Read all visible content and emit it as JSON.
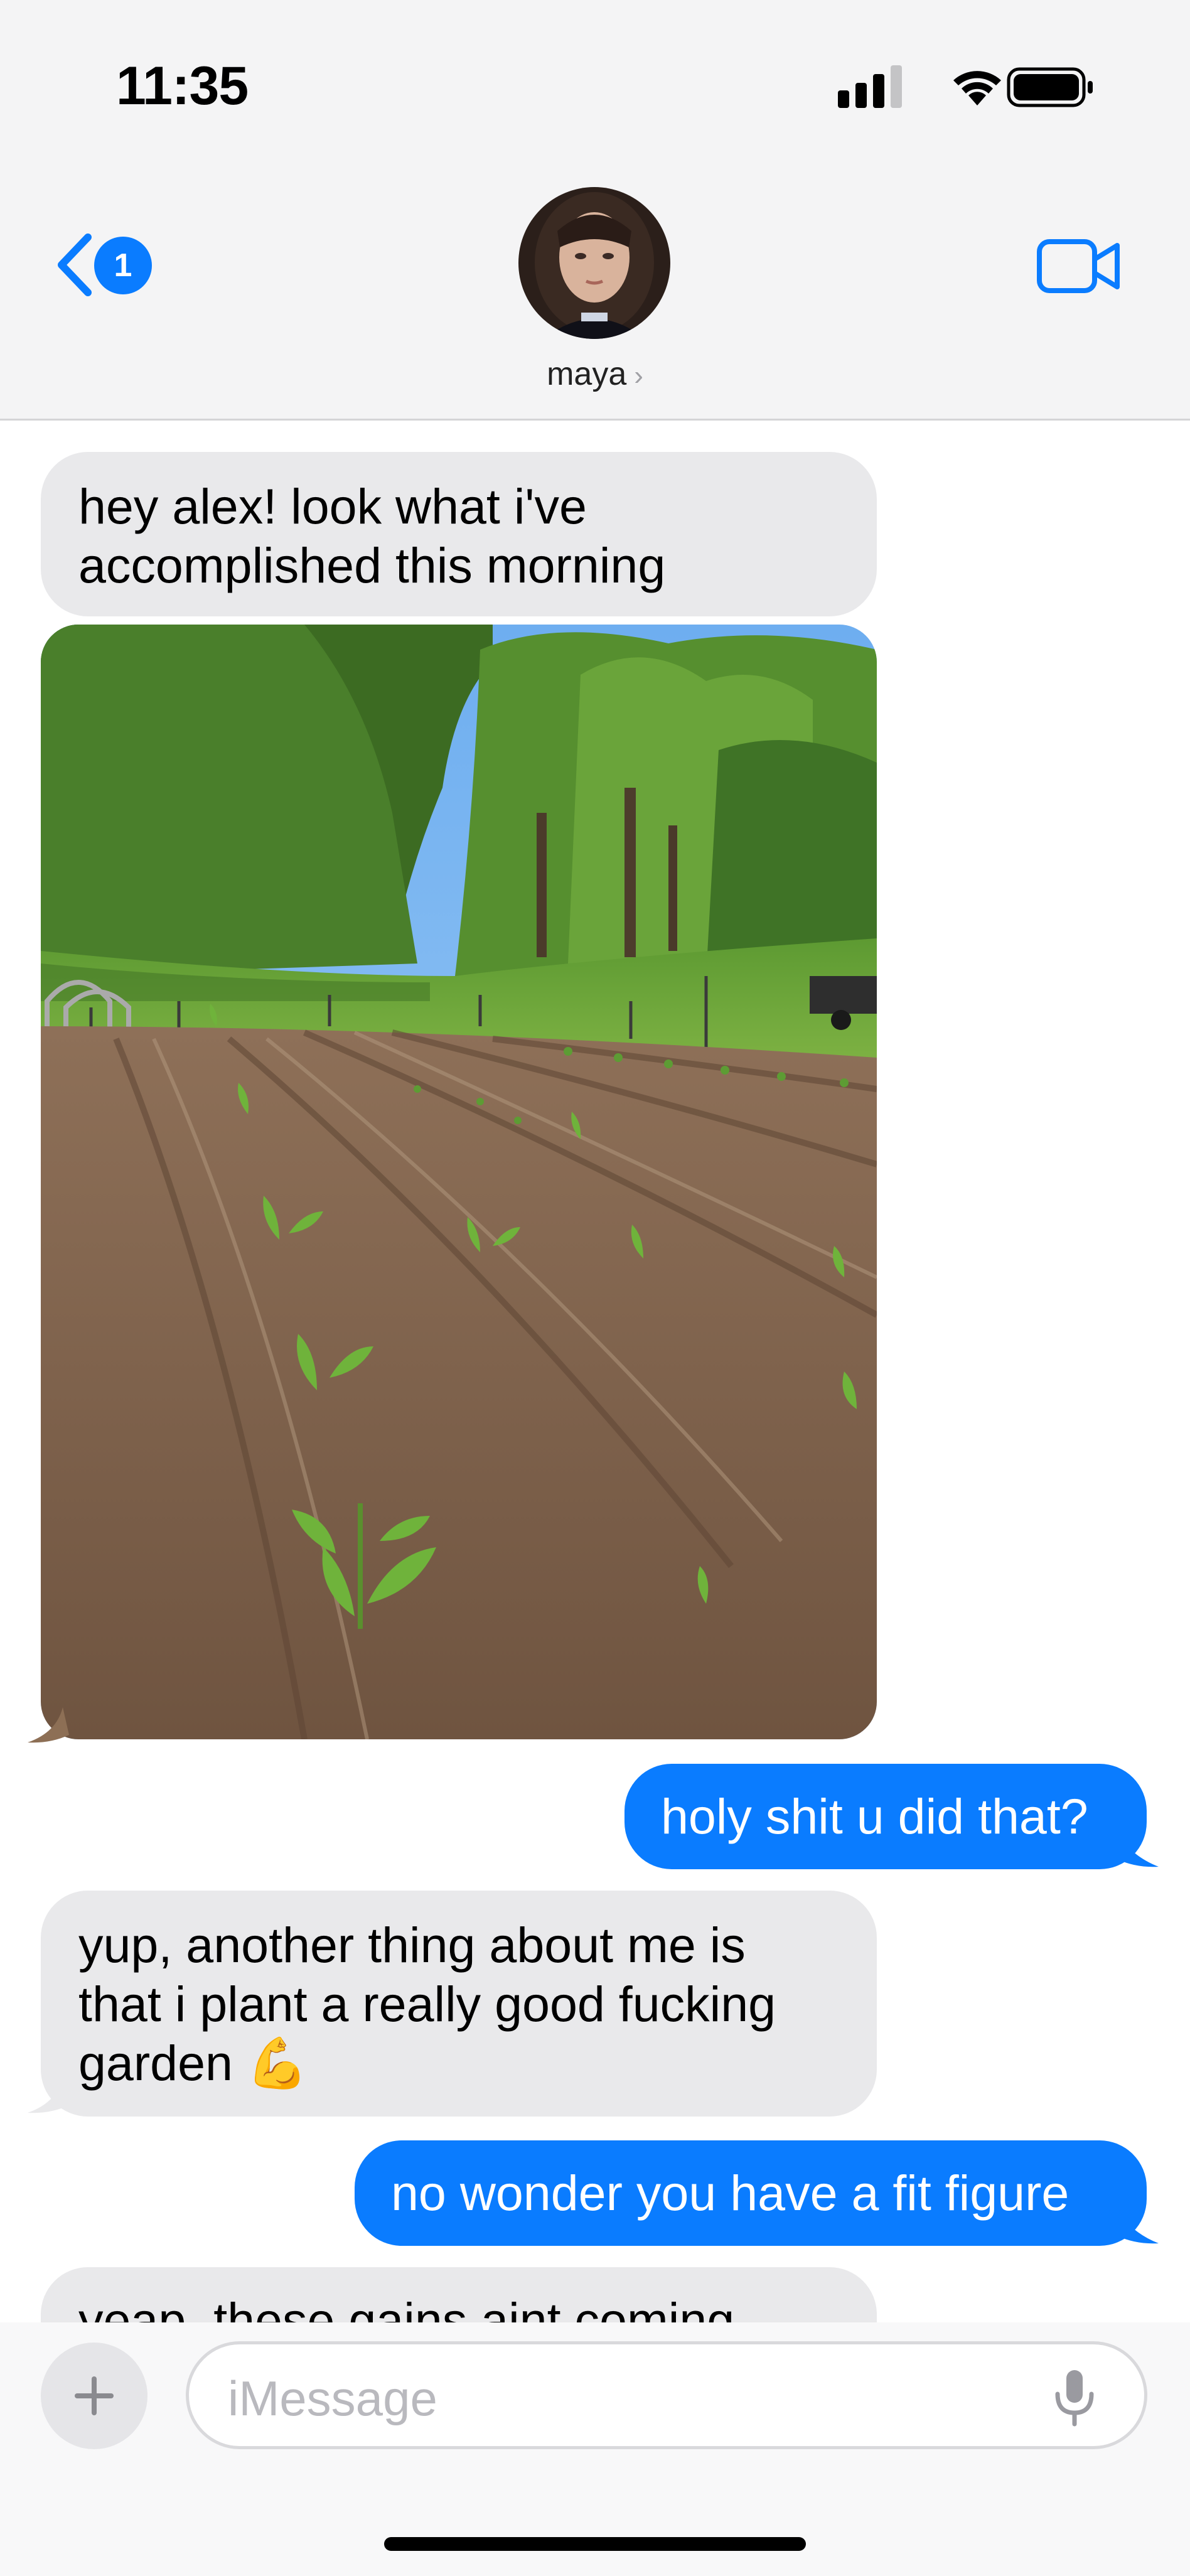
{
  "status_bar": {
    "time": "11:35",
    "icons": [
      "signal-icon",
      "wifi-icon",
      "battery-icon"
    ]
  },
  "header": {
    "back_badge": "1",
    "contact_name": "maya",
    "contact_chevron": "›",
    "icons": {
      "back": "chevron-left-icon",
      "video": "video-camera-icon"
    }
  },
  "messages": [
    {
      "direction": "incoming",
      "text_lines": [
        "hey alex! look what i've",
        "accomplished this morning"
      ]
    },
    {
      "direction": "incoming",
      "type": "photo",
      "subject": "garden-photo"
    },
    {
      "direction": "outgoing",
      "text": "holy shit u did that?"
    },
    {
      "direction": "incoming",
      "text_lines": [
        "yup, another thing about me is",
        "that i plant a really good fucking",
        "garden 💪"
      ]
    },
    {
      "direction": "outgoing",
      "text": "no wonder you have a fit figure"
    },
    {
      "direction": "incoming",
      "text_lines": [
        "yeap, these gains aint coming"
      ]
    }
  ],
  "compose": {
    "placeholder": "iMessage",
    "value": "",
    "icons": {
      "plus": "plus-icon",
      "mic": "microphone-icon"
    }
  },
  "colors": {
    "outgoing_bubble": "#0a7cff",
    "incoming_bubble": "#e9e9eb",
    "header_bg": "#f4f4f5"
  }
}
